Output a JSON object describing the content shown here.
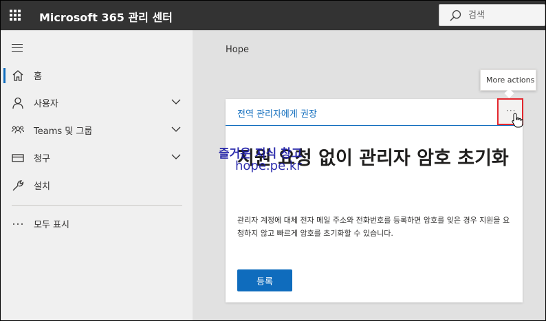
{
  "header": {
    "app_title": "Microsoft 365 관리 센터",
    "search_placeholder": "검색"
  },
  "sidebar": {
    "items": [
      {
        "label": "홈",
        "icon": "home-icon",
        "expandable": false,
        "active": true
      },
      {
        "label": "사용자",
        "icon": "person-icon",
        "expandable": true
      },
      {
        "label": "Teams 및 그룹",
        "icon": "group-icon",
        "expandable": true
      },
      {
        "label": "청구",
        "icon": "billing-icon",
        "expandable": true
      },
      {
        "label": "설치",
        "icon": "wrench-icon",
        "expandable": false
      }
    ],
    "show_all": {
      "label": "모두 표시",
      "icon": "ellipsis-icon"
    }
  },
  "main": {
    "org_name": "Hope",
    "tooltip": "More actions",
    "card": {
      "header_title": "전역 관리자에게 권장",
      "more_label": "···",
      "headline": "지원 요청 없이 관리자 암호 초기화",
      "description": "관리자 계정에 대체 전자 메일 주소와 전화번호를 등록하면 암호를 잊은 경우 지원을 요청하지 않고 빠르게 암호를 초기화할 수 있습니다.",
      "button_label": "등록"
    }
  },
  "watermark": {
    "line1": "즐거운 지식 창고",
    "line2": "hope.pe.kr"
  },
  "colors": {
    "topbar": "#333333",
    "accent": "#0f6cbd",
    "highlight": "#e3262d"
  }
}
